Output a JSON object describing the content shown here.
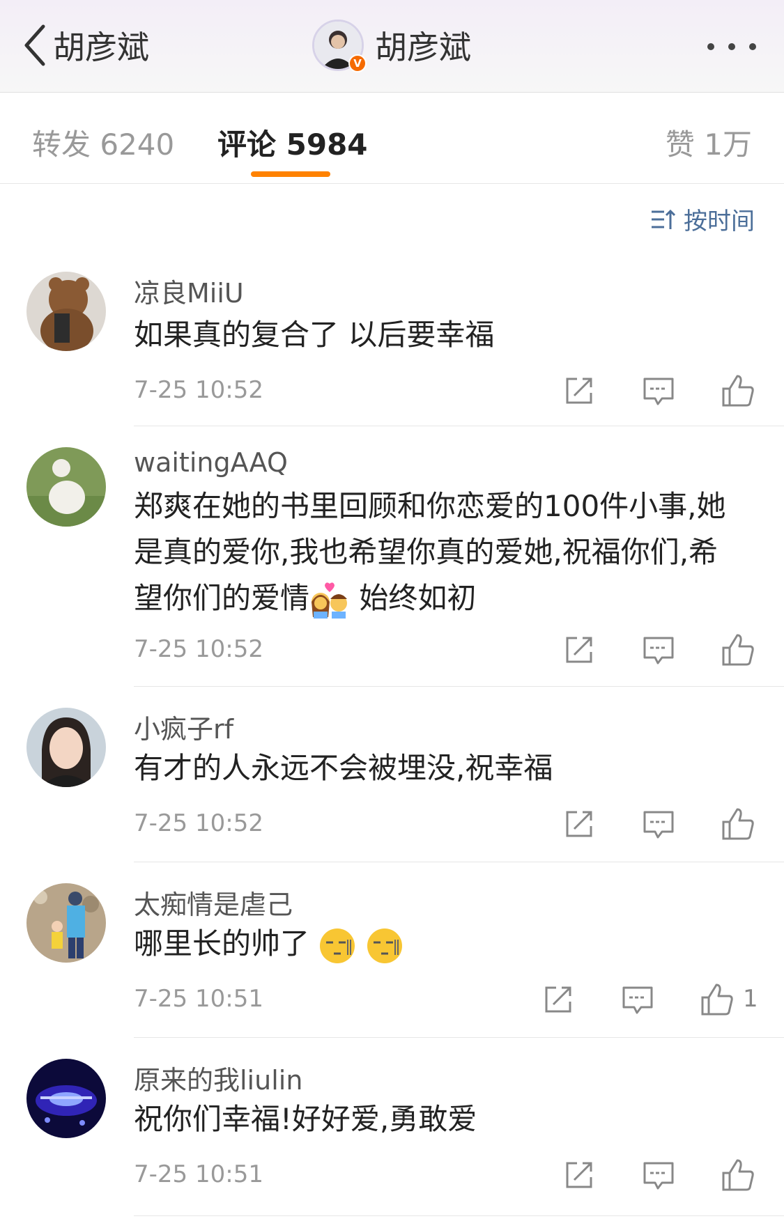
{
  "nav": {
    "back_label": "胡彦斌",
    "title": "胡彦斌",
    "verify_badge": "V"
  },
  "tabs": [
    {
      "label": "转发 6240",
      "active": false
    },
    {
      "label": "评论 5984",
      "active": true
    },
    {
      "label": "赞 1万",
      "active": false
    }
  ],
  "sort": {
    "label": "按时间"
  },
  "comments": [
    {
      "user": "凉良MiiU",
      "text": "如果真的复合了 以后要幸福",
      "time": "7-25 10:52",
      "likes": ""
    },
    {
      "user": "waitingAAQ",
      "text_part1": "郑爽在她的书里回顾和你恋爱的100件小事,她是真的爱你,我也希望你真的爱她,祝福你们,希望你们的爱情",
      "text_part2": "始终如初",
      "time": "7-25 10:52",
      "likes": ""
    },
    {
      "user": "小疯子rf",
      "text": "有才的人永远不会被埋没,祝幸福",
      "time": "7-25 10:52",
      "likes": ""
    },
    {
      "user": "太痴情是虐己",
      "text": "哪里长的帅了",
      "time": "7-25 10:51",
      "likes": "1"
    },
    {
      "user": "原来的我liulin",
      "text": "祝你们幸福!好好爱,勇敢爱",
      "time": "7-25 10:51",
      "likes": ""
    }
  ],
  "colors": {
    "accent": "#ff8200",
    "link": "#4b6e99",
    "muted": "#999999"
  }
}
